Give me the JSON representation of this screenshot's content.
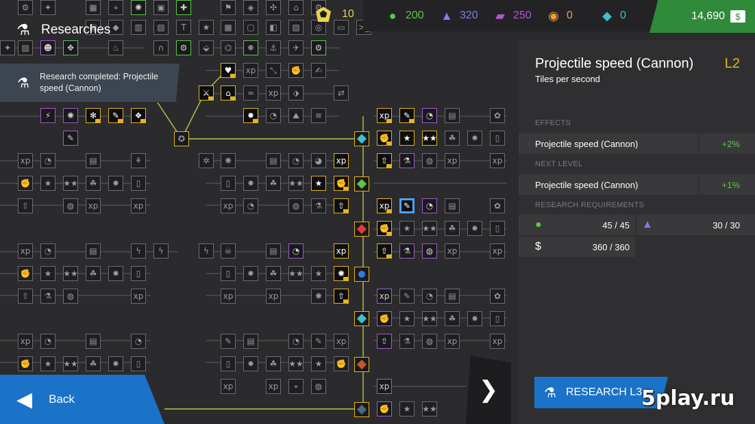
{
  "header": {
    "title": "Researches",
    "title_icon": "flask-icon",
    "population": {
      "icon": "pentagon-token-icon",
      "value": "10"
    }
  },
  "resources": [
    {
      "icon": "green-orb-icon",
      "value": "200",
      "color": "#5cc84a"
    },
    {
      "icon": "blue-triangle-icon",
      "value": "320",
      "color": "#7d7ef0"
    },
    {
      "icon": "purple-stripes-icon",
      "value": "250",
      "color": "#b455d8"
    },
    {
      "icon": "orange-ball-icon",
      "value": "0",
      "color": "#f0a030"
    },
    {
      "icon": "teal-crystal-icon",
      "value": "0",
      "color": "#3fc0c8"
    }
  ],
  "money": {
    "value": "14,690",
    "icon": "banknote-icon"
  },
  "notification": {
    "text": "Research completed: Projectile speed (Cannon)",
    "icon": "flask-icon"
  },
  "panel": {
    "title": "Projectile speed (Cannon)",
    "level": "L2",
    "subtitle": "Tiles per second",
    "effects_header": "EFFECTS",
    "effect": {
      "name": "Projectile speed (Cannon)",
      "value": "+2%"
    },
    "next_level_header": "NEXT LEVEL",
    "next_effect": {
      "name": "Projectile speed (Cannon)",
      "value": "+1%"
    },
    "requirements_header": "RESEARCH REQUIREMENTS",
    "requirements": [
      {
        "icon": "green-orb-icon",
        "value": "45 / 45",
        "color": "#5cc84a"
      },
      {
        "icon": "blue-triangle-icon",
        "value": "30 / 30",
        "color": "#7d7ef0"
      },
      {
        "icon": "banknote-icon",
        "value": "360 / 360",
        "color": "#ffffff"
      }
    ]
  },
  "buttons": {
    "research": "RESEARCH L3",
    "back": "Back"
  },
  "watermark": "5play.ru",
  "tree": {
    "accent_done": "#e8b420",
    "accent_available": "#a55bd1",
    "accent_selected": "#4da3ff"
  }
}
